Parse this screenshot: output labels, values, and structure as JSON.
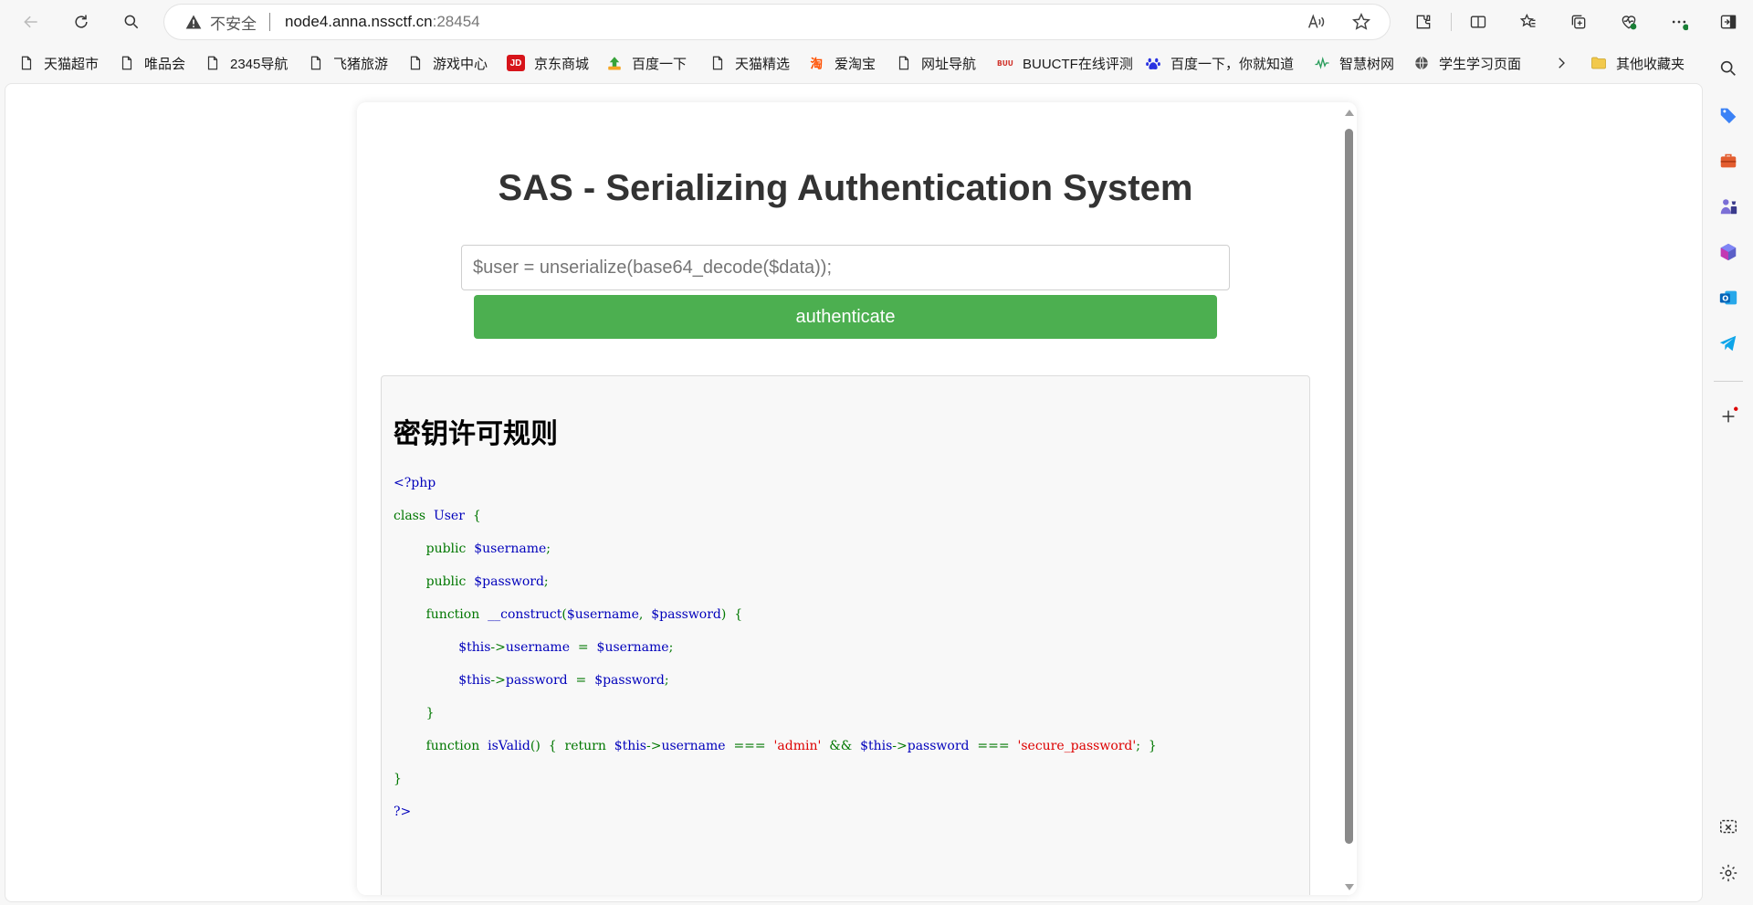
{
  "browser": {
    "address": {
      "insecure_label": "不安全",
      "host": "node4.anna.nssctf.cn",
      "port": ":28454"
    },
    "bookmarks": [
      {
        "label": "天猫超市",
        "icon": "page-icon"
      },
      {
        "label": "唯品会",
        "icon": "page-icon"
      },
      {
        "label": "2345导航",
        "icon": "page-icon"
      },
      {
        "label": "飞猪旅游",
        "icon": "page-icon"
      },
      {
        "label": "游戏中心",
        "icon": "page-icon"
      },
      {
        "label": "京东商城",
        "icon": "jd-icon"
      },
      {
        "label": "百度一下",
        "icon": "2345-icon"
      },
      {
        "label": "天猫精选",
        "icon": "page-icon"
      },
      {
        "label": "爱淘宝",
        "icon": "taobao-icon"
      },
      {
        "label": "网址导航",
        "icon": "page-icon"
      },
      {
        "label": "BUUCTF在线评测",
        "icon": "buuctf-icon"
      },
      {
        "label": "百度一下，你就知道",
        "icon": "baidu-paw-icon"
      },
      {
        "label": "智慧树网",
        "icon": "zhihuishu-icon"
      },
      {
        "label": "学生学习页面",
        "icon": "globe-icon"
      },
      {
        "label": "其他收藏夹",
        "icon": "folder-icon"
      }
    ]
  },
  "page": {
    "title": "SAS - Serializing Authentication System",
    "input_placeholder": "$user = unserialize(base64_decode($data));",
    "button_label": "authenticate",
    "rules_title": "密钥许可规则",
    "code_lines": [
      [
        {
          "t": "<?php",
          "c": "v"
        }
      ],
      [
        {
          "t": "class  ",
          "c": "k"
        },
        {
          "t": "User  ",
          "c": "v"
        },
        {
          "t": "{",
          "c": "k"
        }
      ],
      [
        {
          "t": "        public  ",
          "c": "k"
        },
        {
          "t": "$username",
          "c": "v"
        },
        {
          "t": ";",
          "c": "k"
        }
      ],
      [
        {
          "t": "        public  ",
          "c": "k"
        },
        {
          "t": "$password",
          "c": "v"
        },
        {
          "t": ";",
          "c": "k"
        }
      ],
      [
        {
          "t": "        function  ",
          "c": "k"
        },
        {
          "t": "__construct",
          "c": "v"
        },
        {
          "t": "(",
          "c": "k"
        },
        {
          "t": "$username",
          "c": "v"
        },
        {
          "t": ",  ",
          "c": "k"
        },
        {
          "t": "$password",
          "c": "v"
        },
        {
          "t": ")  {",
          "c": "k"
        }
      ],
      [
        {
          "t": "                ",
          "c": "k"
        },
        {
          "t": "$this",
          "c": "v"
        },
        {
          "t": "->",
          "c": "k"
        },
        {
          "t": "username  ",
          "c": "v"
        },
        {
          "t": "=  ",
          "c": "k"
        },
        {
          "t": "$username",
          "c": "v"
        },
        {
          "t": ";",
          "c": "k"
        }
      ],
      [
        {
          "t": "                ",
          "c": "k"
        },
        {
          "t": "$this",
          "c": "v"
        },
        {
          "t": "->",
          "c": "k"
        },
        {
          "t": "password  ",
          "c": "v"
        },
        {
          "t": "=  ",
          "c": "k"
        },
        {
          "t": "$password",
          "c": "v"
        },
        {
          "t": ";",
          "c": "k"
        }
      ],
      [
        {
          "t": "        }",
          "c": "k"
        }
      ],
      [
        {
          "t": "        function  ",
          "c": "k"
        },
        {
          "t": "isValid",
          "c": "v"
        },
        {
          "t": "()  {  return  ",
          "c": "k"
        },
        {
          "t": "$this",
          "c": "v"
        },
        {
          "t": "->",
          "c": "k"
        },
        {
          "t": "username  ",
          "c": "v"
        },
        {
          "t": "===  ",
          "c": "k"
        },
        {
          "t": "'admin'  ",
          "c": "s"
        },
        {
          "t": "&&  ",
          "c": "k"
        },
        {
          "t": "$this",
          "c": "v"
        },
        {
          "t": "->",
          "c": "k"
        },
        {
          "t": "password  ",
          "c": "v"
        },
        {
          "t": "===  ",
          "c": "k"
        },
        {
          "t": "'secure_password'",
          "c": "s"
        },
        {
          "t": ";  }",
          "c": "k"
        }
      ],
      [
        {
          "t": "}",
          "c": "k"
        }
      ],
      [
        {
          "t": "?>",
          "c": "v"
        }
      ]
    ]
  },
  "colors": {
    "button": "#4caf50",
    "code_keyword": "#007700",
    "code_variable": "#0000bb",
    "code_string": "#dd0000"
  }
}
